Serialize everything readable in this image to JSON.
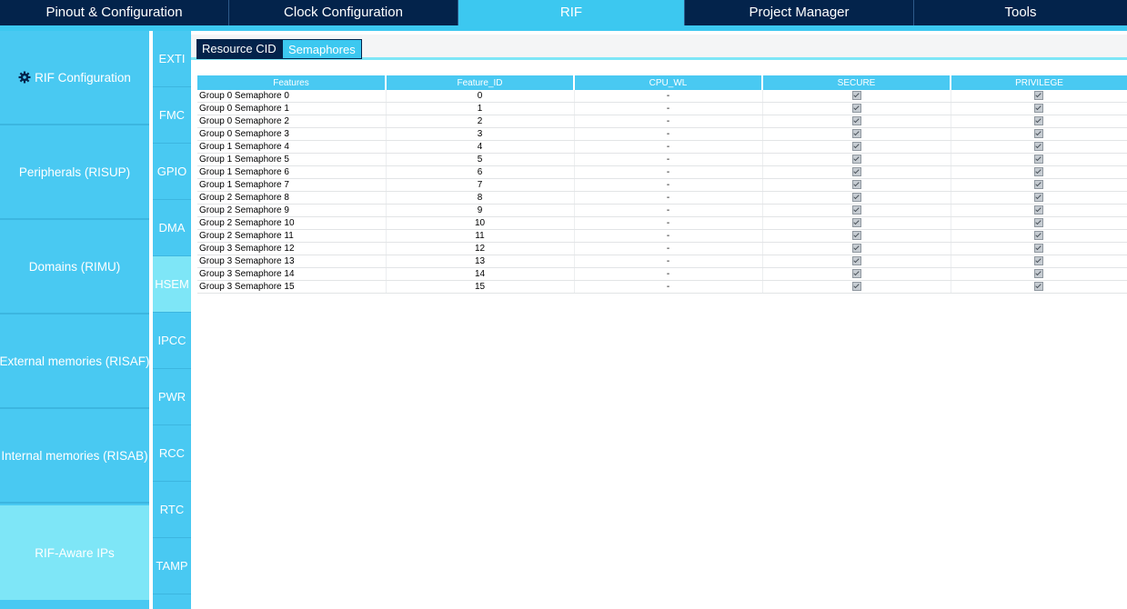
{
  "topnav": {
    "tabs": [
      {
        "label": "Pinout & Configuration"
      },
      {
        "label": "Clock Configuration"
      },
      {
        "label": "RIF"
      },
      {
        "label": "Project Manager"
      },
      {
        "label": "Tools"
      }
    ],
    "active": "RIF"
  },
  "sidebar": {
    "items": [
      {
        "label": "RIF Configuration",
        "icon": "gear-icon"
      },
      {
        "label": "Peripherals (RISUP)"
      },
      {
        "label": "Domains (RIMU)"
      },
      {
        "label": "External memories (RISAF)"
      },
      {
        "label": "Internal memories (RISAB)"
      },
      {
        "label": "RIF-Aware IPs"
      }
    ]
  },
  "iplist": {
    "items": [
      "EXTI",
      "FMC",
      "GPIO",
      "DMA",
      "HSEM",
      "IPCC",
      "PWR",
      "RCC",
      "RTC",
      "TAMP"
    ],
    "active": "HSEM"
  },
  "subtabs": {
    "items": [
      "Resource CID",
      "Semaphores"
    ],
    "active": "Semaphores"
  },
  "table": {
    "columns": [
      "Features",
      "Feature_ID",
      "CPU_WL",
      "SECURE",
      "PRIVILEGE"
    ],
    "rows": [
      {
        "feature": "Group 0 Semaphore 0",
        "id": "0",
        "cpu_wl": "-",
        "secure": true,
        "privilege": true
      },
      {
        "feature": "Group 0 Semaphore 1",
        "id": "1",
        "cpu_wl": "-",
        "secure": true,
        "privilege": true
      },
      {
        "feature": "Group 0 Semaphore 2",
        "id": "2",
        "cpu_wl": "-",
        "secure": true,
        "privilege": true
      },
      {
        "feature": "Group 0 Semaphore 3",
        "id": "3",
        "cpu_wl": "-",
        "secure": true,
        "privilege": true
      },
      {
        "feature": "Group 1 Semaphore 4",
        "id": "4",
        "cpu_wl": "-",
        "secure": true,
        "privilege": true
      },
      {
        "feature": "Group 1 Semaphore 5",
        "id": "5",
        "cpu_wl": "-",
        "secure": true,
        "privilege": true
      },
      {
        "feature": "Group 1 Semaphore 6",
        "id": "6",
        "cpu_wl": "-",
        "secure": true,
        "privilege": true
      },
      {
        "feature": "Group 1 Semaphore 7",
        "id": "7",
        "cpu_wl": "-",
        "secure": true,
        "privilege": true
      },
      {
        "feature": "Group 2 Semaphore 8",
        "id": "8",
        "cpu_wl": "-",
        "secure": true,
        "privilege": true
      },
      {
        "feature": "Group 2 Semaphore 9",
        "id": "9",
        "cpu_wl": "-",
        "secure": true,
        "privilege": true
      },
      {
        "feature": "Group 2 Semaphore 10",
        "id": "10",
        "cpu_wl": "-",
        "secure": true,
        "privilege": true
      },
      {
        "feature": "Group 2 Semaphore 11",
        "id": "11",
        "cpu_wl": "-",
        "secure": true,
        "privilege": true
      },
      {
        "feature": "Group 3 Semaphore 12",
        "id": "12",
        "cpu_wl": "-",
        "secure": true,
        "privilege": true
      },
      {
        "feature": "Group 3 Semaphore 13",
        "id": "13",
        "cpu_wl": "-",
        "secure": true,
        "privilege": true
      },
      {
        "feature": "Group 3 Semaphore 14",
        "id": "14",
        "cpu_wl": "-",
        "secure": true,
        "privilege": true
      },
      {
        "feature": "Group 3 Semaphore 15",
        "id": "15",
        "cpu_wl": "-",
        "secure": true,
        "privilege": true
      }
    ]
  },
  "colors": {
    "navy": "#03234b",
    "accent": "#3cc8f0",
    "panel": "#49c9f2",
    "highlight": "#7ee6f7"
  }
}
